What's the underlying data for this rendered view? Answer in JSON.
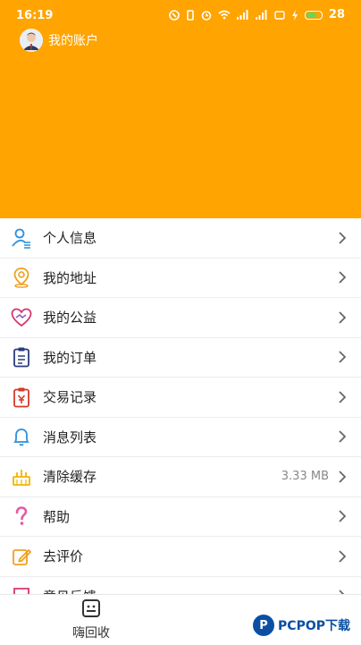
{
  "status_bar": {
    "time": "16:19",
    "battery": "28"
  },
  "header": {
    "account_label": "我的账户",
    "bg_color": "#ffa400"
  },
  "menu": [
    {
      "label": "个人信息",
      "icon": "user-icon",
      "value": ""
    },
    {
      "label": "我的地址",
      "icon": "location-pin-icon",
      "value": ""
    },
    {
      "label": "我的公益",
      "icon": "heart-hands-icon",
      "value": ""
    },
    {
      "label": "我的订单",
      "icon": "clipboard-icon",
      "value": ""
    },
    {
      "label": "交易记录",
      "icon": "receipt-icon",
      "value": ""
    },
    {
      "label": "消息列表",
      "icon": "bell-icon",
      "value": ""
    },
    {
      "label": "清除缓存",
      "icon": "broom-icon",
      "value": "3.33 MB"
    },
    {
      "label": "帮助",
      "icon": "question-icon",
      "value": ""
    },
    {
      "label": "去评价",
      "icon": "edit-icon",
      "value": ""
    },
    {
      "label": "意见反馈",
      "icon": "feedback-icon",
      "value": ""
    }
  ],
  "tabbar": {
    "tab1_label": "嗨回收",
    "watermark": "PCPOP下载"
  }
}
